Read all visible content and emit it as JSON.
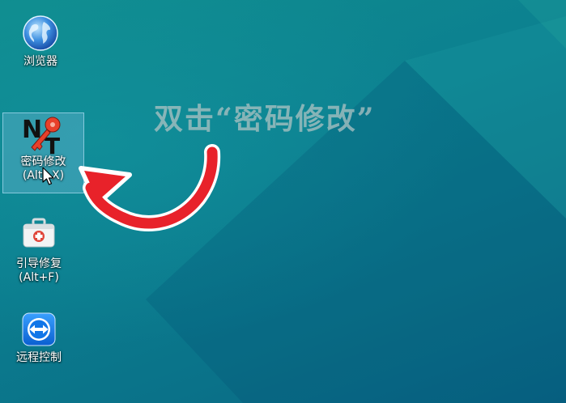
{
  "desktop": {
    "icons": [
      {
        "id": "browser",
        "label": "浏览器",
        "icon": "globe-icon"
      },
      {
        "id": "password",
        "label": "密码修改",
        "sublabel": "(Alt+X)",
        "icon": "nt-key-icon",
        "selected": true
      },
      {
        "id": "boot",
        "label": "引导修复",
        "sublabel": "(Alt+F)",
        "icon": "first-aid-kit-icon"
      },
      {
        "id": "remote",
        "label": "远程控制",
        "icon": "teamviewer-icon"
      }
    ],
    "hint": "双击“密码修改”"
  },
  "colors": {
    "wallpaper": "#0b7f8c",
    "arrow": "#e8222a",
    "selection": "#78bedc"
  }
}
